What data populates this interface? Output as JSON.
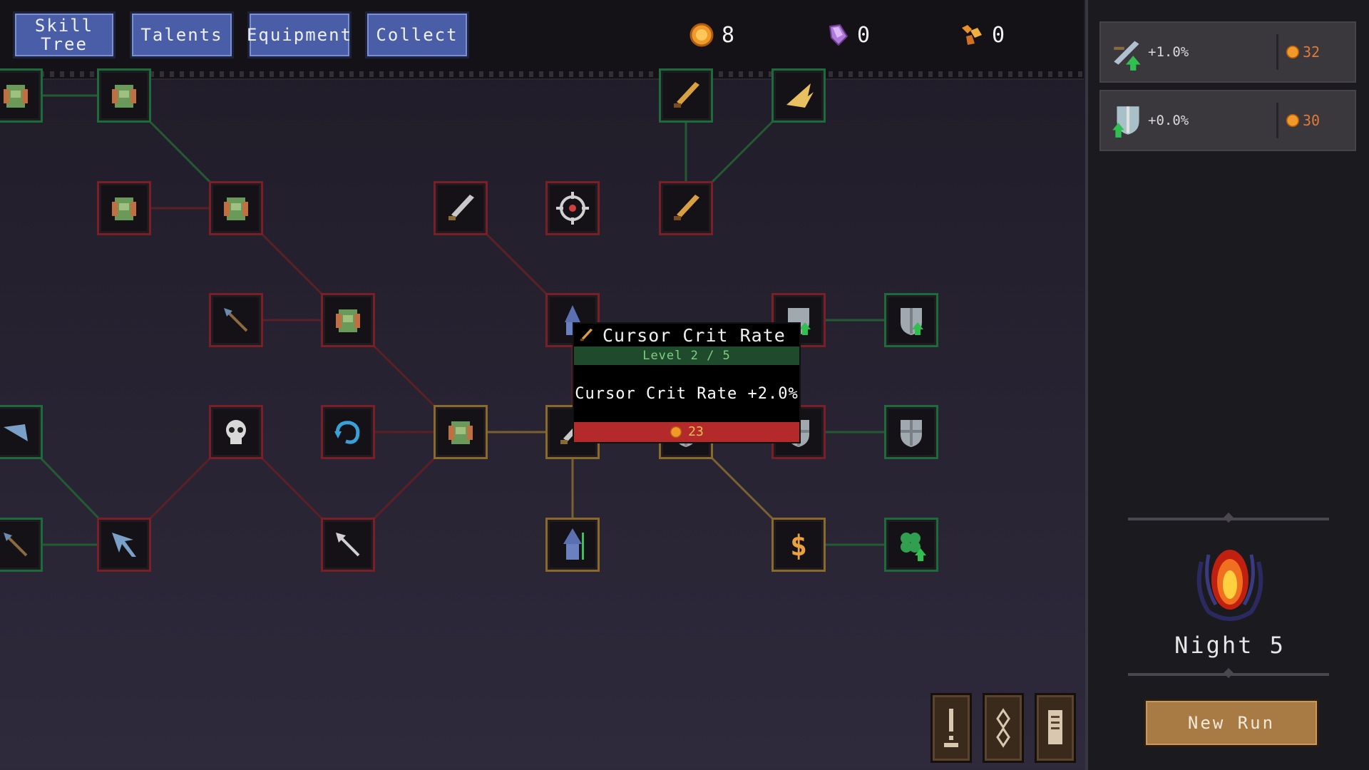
{
  "tabs": [
    {
      "label_line1": "Skill",
      "label_line2": "Tree"
    },
    {
      "label": "Talents"
    },
    {
      "label": "Equipment"
    },
    {
      "label": "Collect"
    }
  ],
  "currencies": [
    {
      "icon": "gold-coin-icon",
      "value": "8",
      "color": "#f09a2a"
    },
    {
      "icon": "purple-crystal-icon",
      "value": "0",
      "color": "#b07ad8"
    },
    {
      "icon": "orange-gem-cluster-icon",
      "value": "0",
      "color": "#e8902a"
    }
  ],
  "tooltip": {
    "title": "Cursor Crit Rate",
    "level": "Level 2 / 5",
    "description": "Cursor Crit Rate +2.0%",
    "cost": "23"
  },
  "side_upgrades": [
    {
      "icon": "crossbow-upgrade-icon",
      "value": "+1.0%",
      "cost": "32"
    },
    {
      "icon": "shield-upgrade-icon",
      "value": "+0.0%",
      "cost": "30"
    }
  ],
  "night": {
    "label": "Night 5"
  },
  "new_run_label": "New Run",
  "bottom_buttons": [
    "exclamation-icon",
    "map-icon",
    "scroll-icon"
  ],
  "colors": {
    "tab_blue": "#4a5ea8",
    "node_red": "#7a1f26",
    "node_green": "#1d6a3a",
    "node_gold": "#8a6a2a",
    "cost_bar": "#b42a2a",
    "level_bar": "#1f4a2c"
  }
}
